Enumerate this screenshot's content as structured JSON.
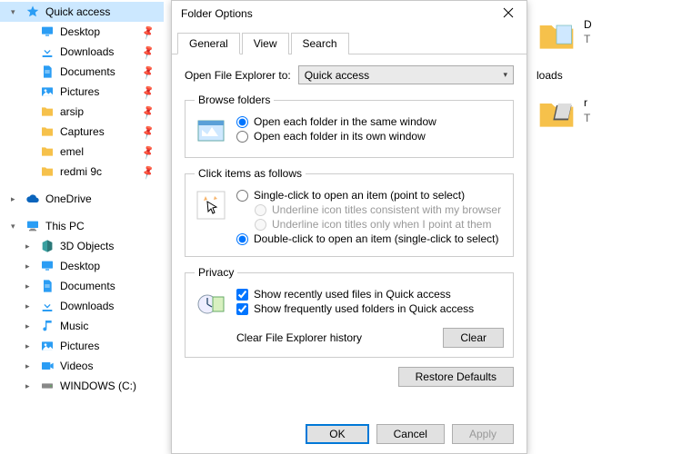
{
  "sidebar": {
    "quick_access": "Quick access",
    "items": [
      {
        "label": "Desktop",
        "pinned": true
      },
      {
        "label": "Downloads",
        "pinned": true
      },
      {
        "label": "Documents",
        "pinned": true
      },
      {
        "label": "Pictures",
        "pinned": true
      },
      {
        "label": "arsip",
        "pinned": true
      },
      {
        "label": "Captures",
        "pinned": true
      },
      {
        "label": "emel",
        "pinned": true
      },
      {
        "label": "redmi 9c",
        "pinned": true
      }
    ],
    "onedrive": "OneDrive",
    "this_pc": "This PC",
    "pc_items": [
      {
        "label": "3D Objects"
      },
      {
        "label": "Desktop"
      },
      {
        "label": "Documents"
      },
      {
        "label": "Downloads"
      },
      {
        "label": "Music"
      },
      {
        "label": "Pictures"
      },
      {
        "label": "Videos"
      },
      {
        "label": "WINDOWS (C:)"
      }
    ]
  },
  "right": {
    "item1_d": "D",
    "item1_t": "T",
    "item2": "loads",
    "item3_r": "r",
    "item3_t": "T"
  },
  "dialog": {
    "title": "Folder Options",
    "tabs": {
      "general": "General",
      "view": "View",
      "search": "Search"
    },
    "open_to_label": "Open File Explorer to:",
    "open_to_value": "Quick access",
    "browse": {
      "legend": "Browse folders",
      "opt1": "Open each folder in the same window",
      "opt2": "Open each folder in its own window"
    },
    "click": {
      "legend": "Click items as follows",
      "opt1": "Single-click to open an item (point to select)",
      "sub1": "Underline icon titles consistent with my browser",
      "sub2": "Underline icon titles only when I point at them",
      "opt2": "Double-click to open an item (single-click to select)"
    },
    "privacy": {
      "legend": "Privacy",
      "chk1": "Show recently used files in Quick access",
      "chk2": "Show frequently used folders in Quick access",
      "clear_label": "Clear File Explorer history",
      "clear_btn": "Clear"
    },
    "restore": "Restore Defaults",
    "ok": "OK",
    "cancel": "Cancel",
    "apply": "Apply"
  }
}
